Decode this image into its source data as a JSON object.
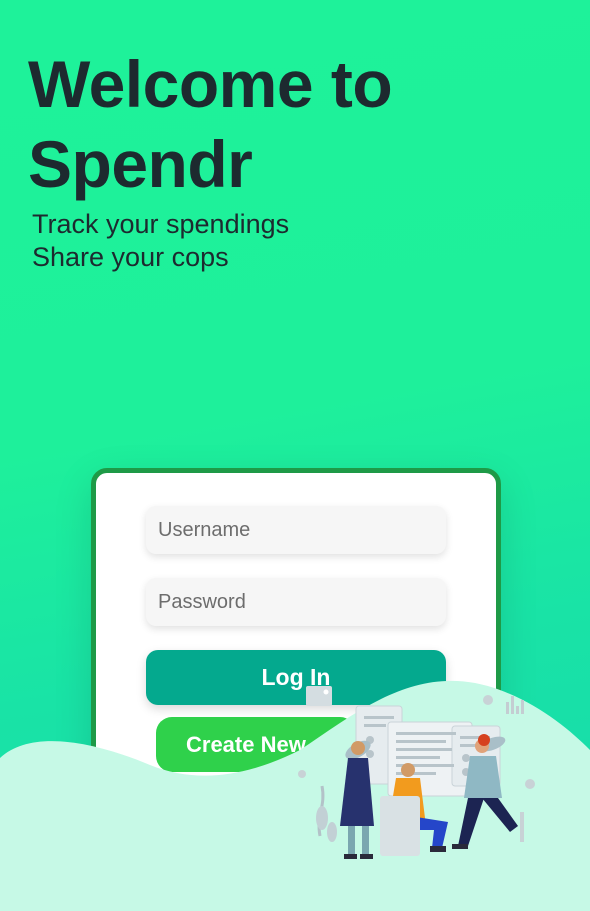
{
  "hero": {
    "title_line1": "Welcome to",
    "title_line2": "Spendr",
    "tagline_line1": "Track your spendings",
    "tagline_line2": "Share your cops"
  },
  "login_form": {
    "username_placeholder": "Username",
    "password_placeholder": "Password",
    "login_label": "Log In",
    "create_label": "Create New"
  },
  "colors": {
    "background": "#1ef29a",
    "card_border": "#1e9a47",
    "login_button": "#04a98e",
    "create_button": "#2fd14b",
    "wave": "#c6f9e6",
    "title_text": "#1d2a2f"
  },
  "illustration": {
    "icon": "team-collaboration-illustration"
  }
}
